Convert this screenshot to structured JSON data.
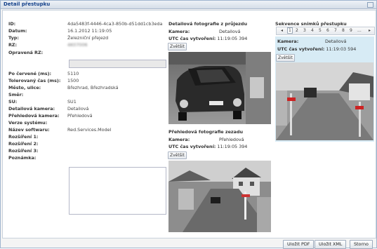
{
  "window": {
    "title": "Detail přestupku"
  },
  "form": {
    "rows": [
      {
        "label": "ID:",
        "value": "4da5483f-4446-4ca3-850b-d51dd1cb3eda"
      },
      {
        "label": "Datum:",
        "value": "16.1.2012 11:19:05"
      },
      {
        "label": "Typ:",
        "value": "Železniční přejezd"
      },
      {
        "label": "RZ:",
        "value": "4K07006"
      },
      {
        "label": "Opravená RZ:",
        "value": ""
      },
      {
        "label": "Po červené (ms):",
        "value": "5110"
      },
      {
        "label": "Tolerovaný čas (ms):",
        "value": "1500"
      },
      {
        "label": "Město, ulice:",
        "value": "Březhrad, Březhradská"
      },
      {
        "label": "Směr:",
        "value": ""
      },
      {
        "label": "SU:",
        "value": "SU1"
      },
      {
        "label": "Detailová kamera:",
        "value": "Detailová"
      },
      {
        "label": "Přehledová kamera:",
        "value": "Přehledová"
      },
      {
        "label": "Verze systému:",
        "value": ""
      },
      {
        "label": "Název softwaru:",
        "value": "Red.Services.Model"
      },
      {
        "label": "Rozšíření 1:",
        "value": ""
      },
      {
        "label": "Rozšíření 2:",
        "value": ""
      },
      {
        "label": "Rozšíření 3:",
        "value": ""
      },
      {
        "label": "Poznámka:",
        "value": ""
      }
    ]
  },
  "detail_photo": {
    "title": "Detailová fotografie z průjezdu",
    "camera_label": "Kamera:",
    "camera_value": "Detailová",
    "utc_label": "UTC čas vytvoření:",
    "utc_value": "11:19:05 394",
    "zoom_button": "Zvětšit"
  },
  "overview_photo": {
    "title": "Přehledová fotografie zezadu",
    "camera_label": "Kamera:",
    "camera_value": "Přehledová",
    "utc_label": "UTC čas vytvoření:",
    "utc_value": "11:19:05 394",
    "zoom_button": "Zvětšit"
  },
  "sequence": {
    "title": "Sekvence snímků přestupku",
    "pages": [
      "1",
      "2",
      "3",
      "4",
      "5",
      "6",
      "7",
      "8",
      "9",
      "..."
    ],
    "current_page": "1",
    "prev_icon": "◂",
    "next_icon": "▸",
    "camera_label": "Kamera:",
    "camera_value": "Detailová",
    "utc_label": "UTC čas vytvoření:",
    "utc_value": "11:19:03 594",
    "zoom_button": "Zvětšit"
  },
  "footer": {
    "save_pdf": "Uložit PDF",
    "save_xml": "Uložit XML",
    "cancel": "Storno"
  }
}
